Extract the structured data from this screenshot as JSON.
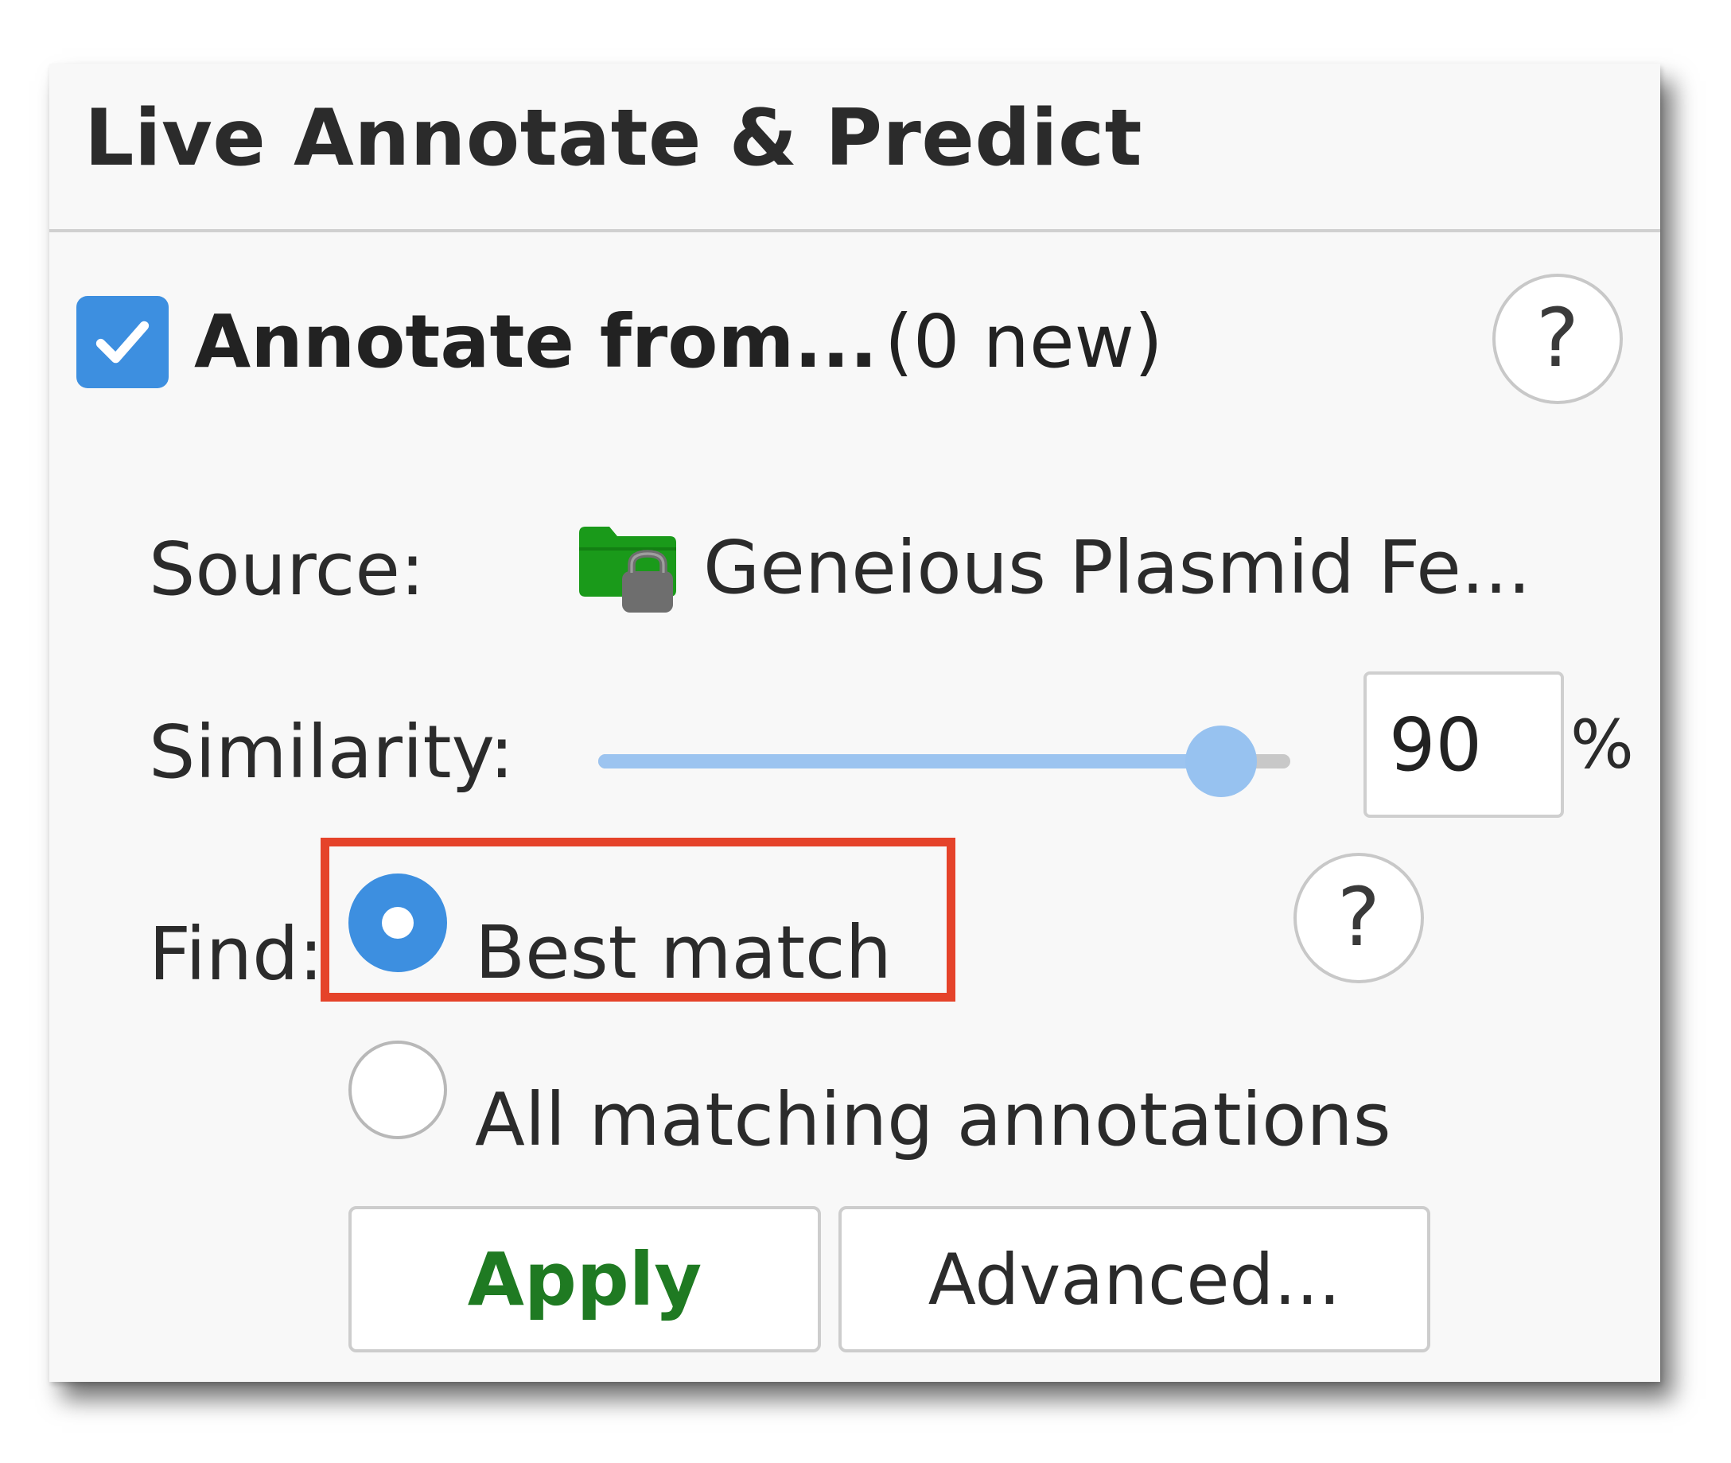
{
  "panel": {
    "title": "Live Annotate & Predict"
  },
  "annotate": {
    "checked": true,
    "label": "Annotate from...",
    "count": "(0 new)"
  },
  "help": {
    "glyph": "?"
  },
  "source": {
    "label": "Source:",
    "icon": "locked-folder-icon",
    "value": "Geneious Plasmid Fe..."
  },
  "similarity": {
    "label": "Similarity:",
    "value": "90",
    "unit": "%",
    "slider_fraction": 0.9
  },
  "find": {
    "label": "Find:",
    "options": [
      {
        "label": "Best match",
        "selected": true
      },
      {
        "label": "All matching annotations",
        "selected": false
      }
    ]
  },
  "buttons": {
    "apply_label": "Apply",
    "advanced_label": "Advanced..."
  },
  "colors": {
    "accent": "#3d8fe0",
    "highlight": "#e5432a",
    "apply_text": "#1f7a22",
    "folder": "#1a9a1a"
  }
}
